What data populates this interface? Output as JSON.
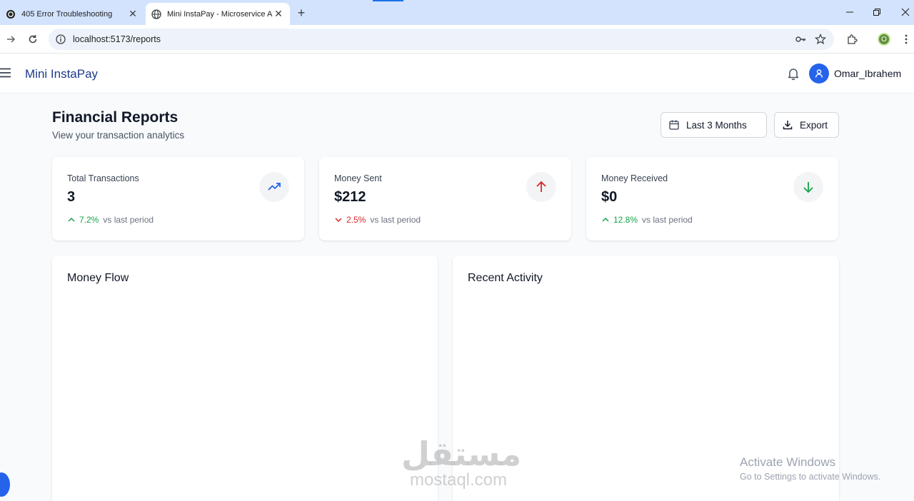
{
  "browser": {
    "tabs": [
      {
        "title": "405 Error Troubleshooting",
        "active": false
      },
      {
        "title": "Mini InstaPay - Microservice Ar",
        "active": true
      }
    ],
    "new_tab": "+",
    "url": "localhost:5173/reports",
    "profile_initial": "O"
  },
  "app": {
    "brand": "Mini InstaPay",
    "username": "Omar_Ibrahem",
    "accent_color": "#2563eb",
    "brand_color": "#1e3a8a"
  },
  "page": {
    "title": "Financial Reports",
    "subtitle": "View your transaction analytics",
    "range_label": "Last 3 Months",
    "export_label": "Export"
  },
  "stats": [
    {
      "label": "Total Transactions",
      "value": "3",
      "trend_pct": "7.2%",
      "trend_dir": "up",
      "vs": "vs last period",
      "icon": "trending-up-icon",
      "trend_color": "#16a34a",
      "icon_color": "#2563eb"
    },
    {
      "label": "Money Sent",
      "value": "$212",
      "trend_pct": "2.5%",
      "trend_dir": "down",
      "vs": "vs last period",
      "icon": "arrow-up-icon",
      "trend_color": "#dc2626",
      "icon_color": "#dc2626"
    },
    {
      "label": "Money Received",
      "value": "$0",
      "trend_pct": "12.8%",
      "trend_dir": "up",
      "vs": "vs last period",
      "icon": "arrow-down-icon",
      "trend_color": "#16a34a",
      "icon_color": "#16a34a"
    }
  ],
  "panels": {
    "money_flow": "Money Flow",
    "recent_activity": "Recent Activity"
  },
  "overlay": {
    "watermark_ar": "مستقل",
    "watermark_latin": "mostaql.com",
    "activate_title": "Activate Windows",
    "activate_sub": "Go to Settings to activate Windows."
  }
}
